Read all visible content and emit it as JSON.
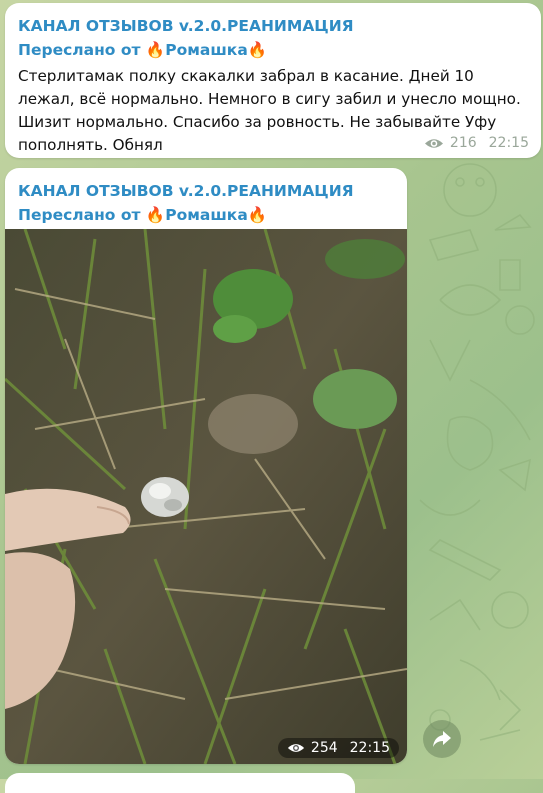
{
  "messages": [
    {
      "channel": "КАНАЛ ОТЗЫВОВ v.2.0.РЕАНИМАЦИЯ",
      "forwarded_prefix": "Переслано от",
      "forwarded_name": "Ромашка",
      "fire_emoji": "🔥",
      "text": "Стерлитамак полку скакалки забрал в касание. Дней 10 лежал, всё нормально. Немного в сигу забил и унесло мощно. Шизит нормально. Спасибо за ровность. Не забывайте Уфу пополнять. Обнял",
      "views": "216",
      "time": "22:15"
    },
    {
      "channel": "КАНАЛ ОТЗЫВОВ v.2.0.РЕАНИМАЦИЯ",
      "forwarded_prefix": "Переслано от",
      "forwarded_name": "Ромашка",
      "fire_emoji": "🔥",
      "views": "254",
      "time": "22:15"
    }
  ],
  "icons": {
    "views": "eye-icon",
    "share": "share-arrow-icon"
  },
  "colors": {
    "channel_name": "#2f8cc4",
    "meta_text": "#9aa79a",
    "bubble": "#ffffff"
  }
}
